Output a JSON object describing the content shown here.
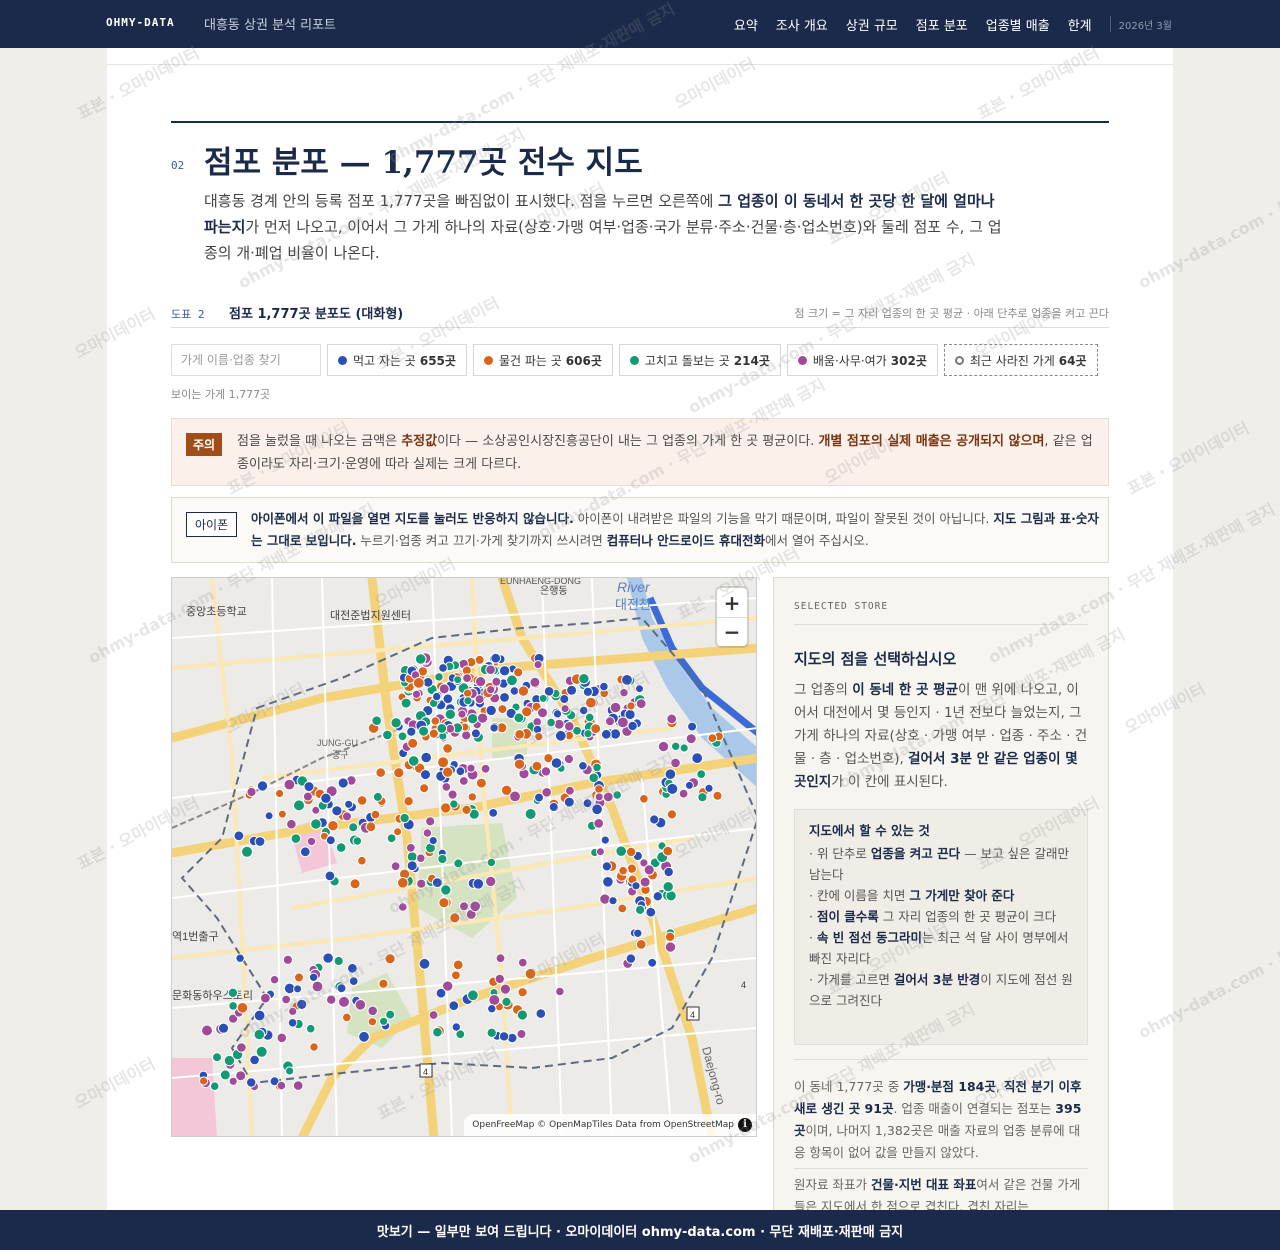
{
  "header": {
    "brand": "OHMY-DATA",
    "subtitle": "대흥동 상권 분석 리포트",
    "nav": [
      "요약",
      "조사 개요",
      "상권 규모",
      "점포 분포",
      "업종별 매출",
      "한계"
    ],
    "date": "2026년 3월"
  },
  "section": {
    "number": "02",
    "title": "점포 분포 — 1,777곳 전수 지도",
    "intro_1": "대흥동 경계 안의 등록 점포 1,777곳을 빠짐없이 표시했다. 점을 누르면 오른쪽에 ",
    "intro_bold": "그 업종이 이 동네서 한 곳당 한 달에 얼마나 파는지",
    "intro_2": "가 먼저 나오고, 이어서 그 가게 하나의 자료(상호·가맹 여부·업종·국가 분류·주소·건물·층·업소번호)와 둘레 점포 수, 그 업종의 개·폐업 비율이 나온다."
  },
  "figure": {
    "label": "도표 2",
    "title": "점포 1,777곳 분포도 (대화형)",
    "note": "점 크기 = 그 자리 업종의 한 곳 평균 · 아래 단추로 업종을 켜고 끈다",
    "search_placeholder": "가게 이름·업종 찾기",
    "filters": [
      {
        "label": "먹고 자는 곳",
        "count": "655곳",
        "color": "#2a4fb5"
      },
      {
        "label": "물건 파는 곳",
        "count": "606곳",
        "color": "#d9651b"
      },
      {
        "label": "고치고 돌보는 곳",
        "count": "214곳",
        "color": "#139a74"
      },
      {
        "label": "배움·사무·여가",
        "count": "302곳",
        "color": "#a04a9a"
      },
      {
        "label": "최근 사라진 가게",
        "count": "64곳",
        "color": "#777777"
      }
    ],
    "visible_count": "보이는 가게 1,777곳"
  },
  "warning": {
    "tag": "주의",
    "text_1": "점을 눌렀을 때 나오는 금액은 ",
    "bold_1": "추정값",
    "text_2": "이다 — 소상공인시장진흥공단이 내는 그 업종의 가게 한 곳 평균이다. ",
    "bold_2": "개별 점포의 실제 매출은 공개되지 않으며",
    "text_3": ", 같은 업종이라도 자리·크기·운영에 따라 실제는 크게 다르다."
  },
  "iphone_notice": {
    "tag": "아이폰",
    "bold_1": "아이폰에서 이 파일을 열면 지도를 눌러도 반응하지 않습니다.",
    "text_1": " 아이폰이 내려받은 파일의 기능을 막기 때문이며, 파일이 잘못된 것이 아닙니다. ",
    "bold_2": "지도 그림과 표·숫자는 그대로 보입니다.",
    "text_2": " 누르기·업종 켜고 끄기·가게 찾기까지 쓰시려면 ",
    "bold_3": "컴퓨터나 안드로이드 휴대전화",
    "text_3": "에서 열어 주십시오."
  },
  "map": {
    "zoom_in": "+",
    "zoom_out": "−",
    "attribution": "OpenFreeMap © OpenMapTiles Data from OpenStreetMap",
    "info": "i",
    "labels": [
      "EUNHAENG-DONG",
      "은행동",
      "River",
      "대전천",
      "중앙초등학교",
      "대전준법지원센터",
      "JUNG-GU",
      "중구",
      "역1번출구",
      "문화동하우스토리",
      "Daejong-ro",
      "4",
      "4",
      "4"
    ]
  },
  "panel": {
    "label": "SELECTED STORE",
    "title": "지도의 점을 선택하십시오",
    "desc_1": "그 업종의 ",
    "desc_bold_1": "이 동네 한 곳 평균",
    "desc_2": "이 맨 위에 나오고, 이어서 대전에서 몇 등인지 · 1년 전보다 늘었는지, 그 가게 하나의 자료(상호 · 가맹 여부 · 업종 · 주소 · 건물 · 층 · 업소번호), ",
    "desc_bold_2": "걸어서 3분 안 같은 업종이 몇 곳인지",
    "desc_3": "가 이 칸에 표시된다.",
    "howto_title": "지도에서 할 수 있는 것",
    "howto": [
      {
        "pre": "· 위 단추로 ",
        "bold": "업종을 켜고 끈다",
        "post": " — 보고 싶은 갈래만 남는다"
      },
      {
        "pre": "· 칸에 이름을 치면 ",
        "bold": "그 가게만 찾아 준다",
        "post": ""
      },
      {
        "pre": "· ",
        "bold": "점이 클수록",
        "post": " 그 자리 업종의 한 곳 평균이 크다"
      },
      {
        "pre": "· ",
        "bold": "속 빈 점선 동그라미",
        "post": "는 최근 석 달 사이 명부에서 빠진 자리다"
      },
      {
        "pre": "· 가게를 고르면 ",
        "bold": "걸어서 3분 반경",
        "post": "이 지도에 점선 원으로 그려진다"
      }
    ],
    "stats_1": "이 동네 1,777곳 중 ",
    "stats_bold_1": "가맹·분점 184곳",
    "stats_2": ", ",
    "stats_bold_2": "직전 분기 이후 새로 생긴 곳 91곳",
    "stats_3": ". 업종 매출이 연결되는 점포는 ",
    "stats_bold_3": "395곳",
    "stats_4": "이며, 나머지 1,382곳은 매출 자료의 업종 분류에 대응 항목이 없어 값을 만들지 않았다.",
    "coord_1": "원자료 좌표가 ",
    "coord_bold": "건물·지번 대표 좌표",
    "coord_2": "여서 같은 건물 가게들은 지도에서 한 점으로 겹친다. 겹친 자리는"
  },
  "footer": {
    "text": "맛보기 — 일부만 보여 드립니다 · 오마이데이터 ohmy-data.com · 무단 재배포·재판매 금지"
  },
  "watermark": [
    "표본 · 오마이데이터",
    "ohmy-data.com · 무단 재배포·재판매 금지",
    "오마이데이터"
  ]
}
